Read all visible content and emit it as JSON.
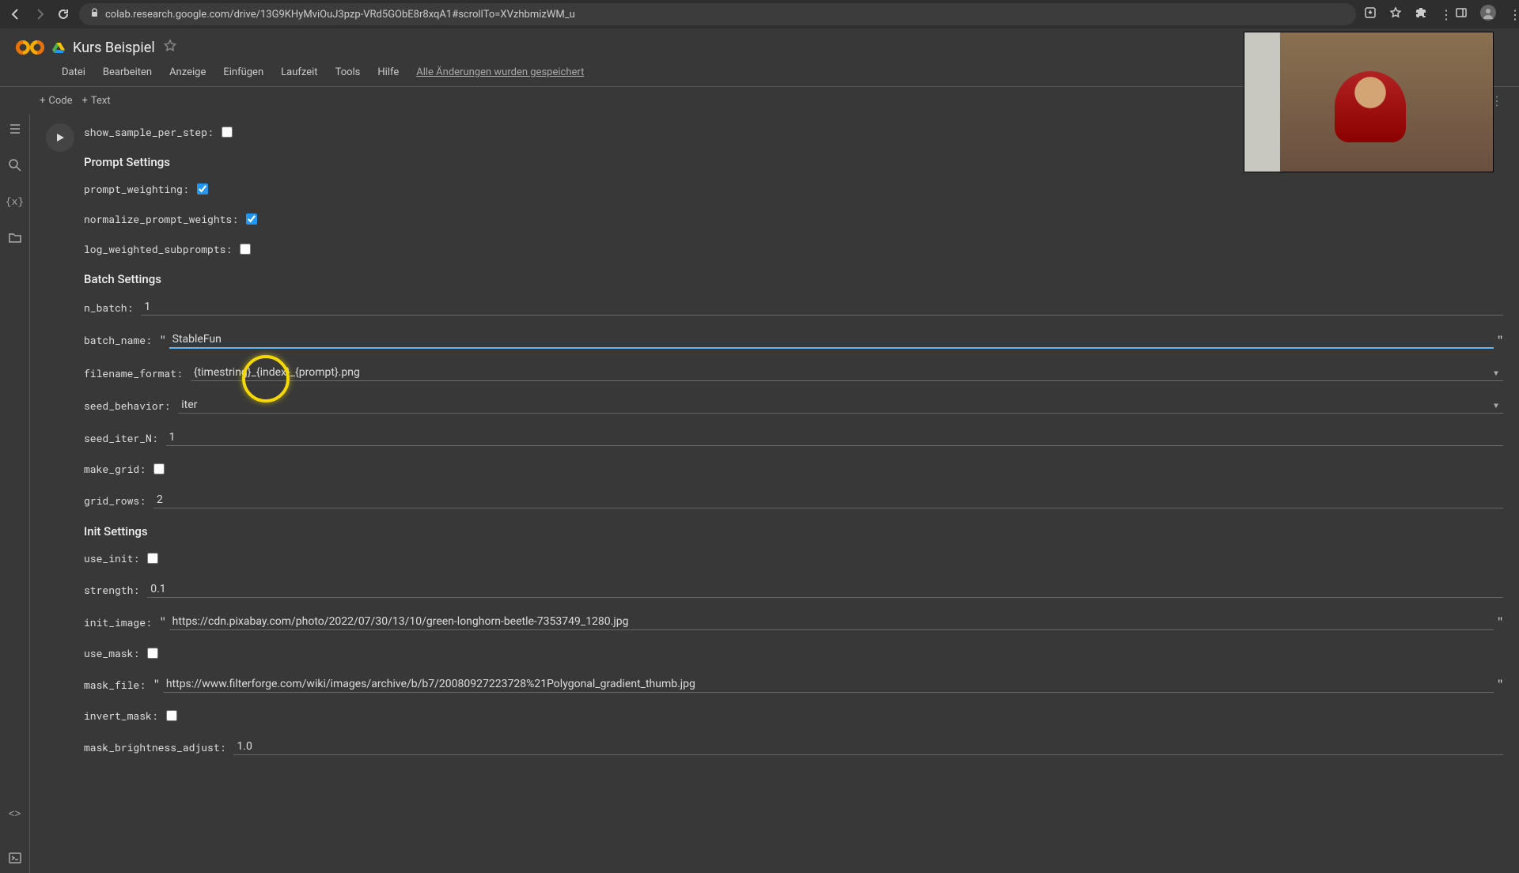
{
  "browser": {
    "url": "colab.research.google.com/drive/13G9KHyMviOuJ3pzp-VRd5GObE8r8xqA1#scrollTo=XVzhbmizWM_u"
  },
  "header": {
    "doc_title": "Kurs Beispiel",
    "menu": {
      "datei": "Datei",
      "bearbeiten": "Bearbeiten",
      "anzeige": "Anzeige",
      "einfugen": "Einfügen",
      "laufzeit": "Laufzeit",
      "tools": "Tools",
      "hilfe": "Hilfe",
      "saved": "Alle Änderungen wurden gespeichert"
    }
  },
  "toolbar": {
    "code": "Code",
    "text": "Text"
  },
  "form": {
    "show_sample_per_step_label": "show_sample_per_step:",
    "prompt_section": "Prompt Settings",
    "prompt_weighting_label": "prompt_weighting:",
    "normalize_prompt_weights_label": "normalize_prompt_weights:",
    "log_weighted_subprompts_label": "log_weighted_subprompts:",
    "batch_section": "Batch Settings",
    "n_batch_label": "n_batch:",
    "n_batch_value": "1",
    "batch_name_label": "batch_name:",
    "batch_name_value": "StableFun",
    "filename_format_label": "filename_format:",
    "filename_format_value": "{timestring}_{index}_{prompt}.png",
    "seed_behavior_label": "seed_behavior:",
    "seed_behavior_value": "iter",
    "seed_iter_n_label": "seed_iter_N:",
    "seed_iter_n_value": "1",
    "make_grid_label": "make_grid:",
    "grid_rows_label": "grid_rows:",
    "grid_rows_value": "2",
    "init_section": "Init Settings",
    "use_init_label": "use_init:",
    "strength_label": "strength:",
    "strength_value": "0.1",
    "init_image_label": "init_image:",
    "init_image_value": "https://cdn.pixabay.com/photo/2022/07/30/13/10/green-longhorn-beetle-7353749_1280.jpg",
    "use_mask_label": "use_mask:",
    "mask_file_label": "mask_file:",
    "mask_file_value": "https://www.filterforge.com/wiki/images/archive/b/b7/20080927223728%21Polygonal_gradient_thumb.jpg",
    "invert_mask_label": "invert_mask:",
    "mask_brightness_adjust_label": "mask_brightness_adjust:",
    "mask_brightness_adjust_value": "1.0"
  }
}
